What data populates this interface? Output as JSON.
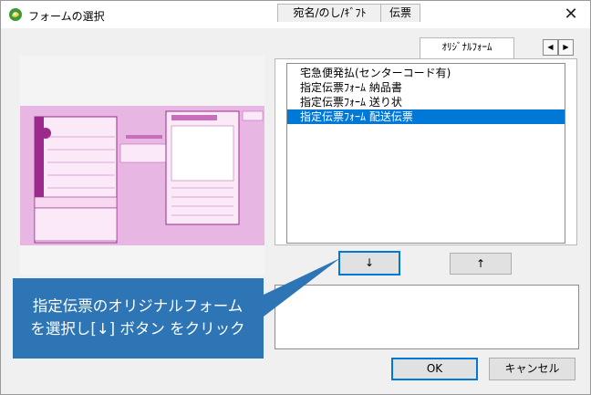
{
  "window": {
    "title": "フォームの選択",
    "close_glyph": "✕"
  },
  "tabs": [
    {
      "label": "宛名/のし/ｷﾞﾌﾄ"
    },
    {
      "label": "伝票"
    },
    {
      "label": "ｵﾘｼﾞﾅﾙﾌｫｰﾑ"
    }
  ],
  "tab_scroll": {
    "left": "◀",
    "right": "▶"
  },
  "list": {
    "items": [
      "宅急便発払(センターコード有)",
      "指定伝票ﾌｫｰﾑ 納品書",
      "指定伝票ﾌｫｰﾑ 送り状",
      "指定伝票ﾌｫｰﾑ 配送伝票"
    ],
    "selected_index": 3
  },
  "buttons": {
    "down": "↓",
    "up": "↑",
    "ok": "OK",
    "cancel": "キャンセル"
  },
  "callout": {
    "line1": "指定伝票のオリジナルフォーム",
    "line2": "を選択し[↓] ボタン をクリック",
    "color": "#2e75b6"
  },
  "colors": {
    "selection": "#0078d7",
    "preview_pink": "#e6b3e0",
    "preview_line": "#9b2a8c"
  }
}
